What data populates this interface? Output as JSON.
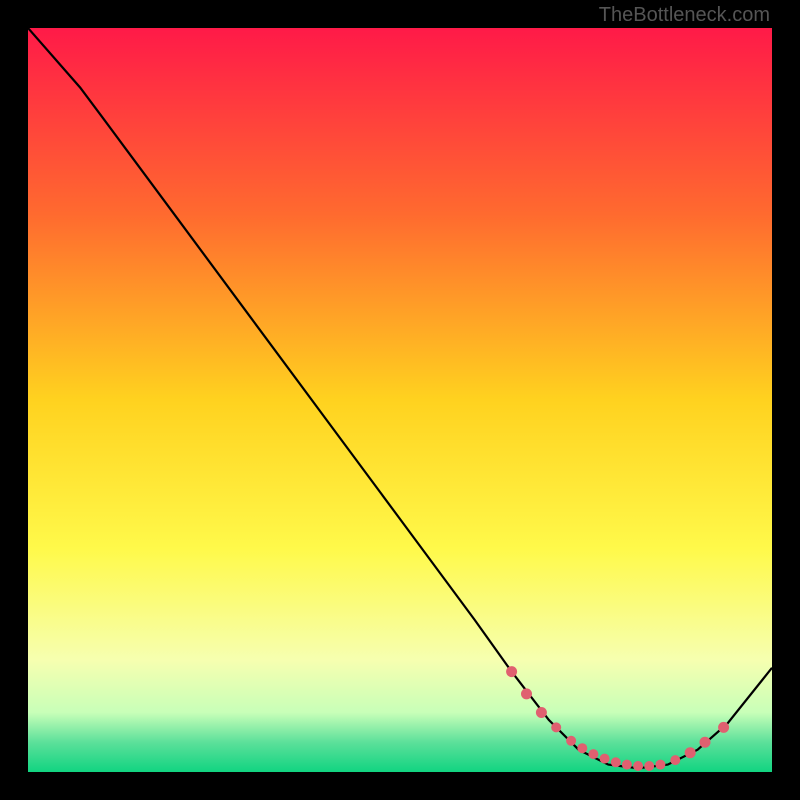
{
  "watermark": "TheBottleneck.com",
  "chart_data": {
    "type": "line",
    "title": "",
    "xlabel": "",
    "ylabel": "",
    "xlim": [
      0,
      100
    ],
    "ylim": [
      0,
      100
    ],
    "grid": false,
    "legend": false,
    "background_gradient": {
      "stops": [
        {
          "offset": 0,
          "color": "#ff1a48"
        },
        {
          "offset": 25,
          "color": "#ff6a2f"
        },
        {
          "offset": 50,
          "color": "#ffd21f"
        },
        {
          "offset": 70,
          "color": "#fff94a"
        },
        {
          "offset": 85,
          "color": "#f6ffb0"
        },
        {
          "offset": 92,
          "color": "#c8ffb8"
        },
        {
          "offset": 96,
          "color": "#5ce09a"
        },
        {
          "offset": 100,
          "color": "#11d481"
        }
      ]
    },
    "series": [
      {
        "name": "curve",
        "color": "#000000",
        "x": [
          0,
          7,
          10,
          20,
          30,
          40,
          50,
          60,
          65,
          70,
          74,
          78,
          82,
          86,
          90,
          94,
          100
        ],
        "y": [
          100,
          92,
          88,
          74.5,
          61,
          47.5,
          34,
          20.5,
          13.5,
          7,
          3,
          1,
          0.5,
          1,
          3,
          6.5,
          14
        ]
      }
    ],
    "marker_points": {
      "name": "optimal-zone",
      "color": "#e06070",
      "x": [
        65,
        67,
        69,
        71,
        73,
        74.5,
        76,
        77.5,
        79,
        80.5,
        82,
        83.5,
        85,
        87,
        89,
        91,
        93.5
      ],
      "y": [
        13.5,
        10.5,
        8,
        6,
        4.2,
        3.2,
        2.4,
        1.8,
        1.3,
        1,
        0.8,
        0.8,
        1,
        1.6,
        2.6,
        4,
        6
      ]
    }
  }
}
